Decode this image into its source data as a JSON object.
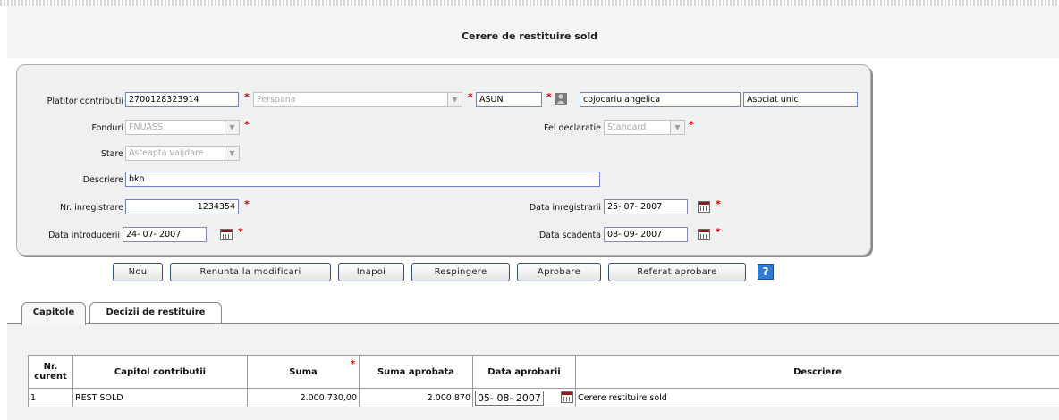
{
  "page_title": "Cerere de restituire sold",
  "form": {
    "platitor_label": "Platitor contributii",
    "platitor_cnp": "2700128323914",
    "platitor_tip": "Persoana",
    "cod": "ASUN",
    "nume": "cojocariu angelica",
    "calitate": "Asociat unic",
    "fonduri_label": "Fonduri",
    "fonduri_value": "FNUASS",
    "fel_declaratie_label": "Fel declaratie",
    "fel_declaratie_value": "Standard",
    "stare_label": "Stare",
    "stare_value": "Asteapta validare",
    "descriere_label": "Descriere",
    "descriere_value": "bkh",
    "nr_inregistrare_label": "Nr. inregistrare",
    "nr_inregistrare_value": "1234354",
    "data_inregistrarii_label": "Data inregistrarii",
    "data_inregistrarii_value": "25- 07-  2007",
    "data_introducerii_label": "Data introducerii",
    "data_introducerii_value": "24- 07-  2007",
    "data_scadenta_label": "Data scadenta",
    "data_scadenta_value": "08- 09-  2007",
    "required_mark": "*"
  },
  "buttons": {
    "nou": "Nou",
    "renunta": "Renunta la modificari",
    "inapoi": "Inapoi",
    "respingere": "Respingere",
    "aprobare": "Aprobare",
    "referat": "Referat aprobare",
    "help": "?"
  },
  "tabs": [
    "Capitole",
    "Decizii de restituire"
  ],
  "table": {
    "headers": [
      "Nr. curent",
      "Capitol contributii",
      "Suma",
      "Suma aprobata",
      "Data aprobarii",
      "Descriere"
    ],
    "suma_required": "*",
    "rows": [
      {
        "nr": "1",
        "capitol": "REST SOLD",
        "suma": "2.000.730,00",
        "suma_aprobata": "2.000.870",
        "data_aprobarii": "05- 08- 2007",
        "descriere": "Cerere restituire sold"
      }
    ]
  }
}
